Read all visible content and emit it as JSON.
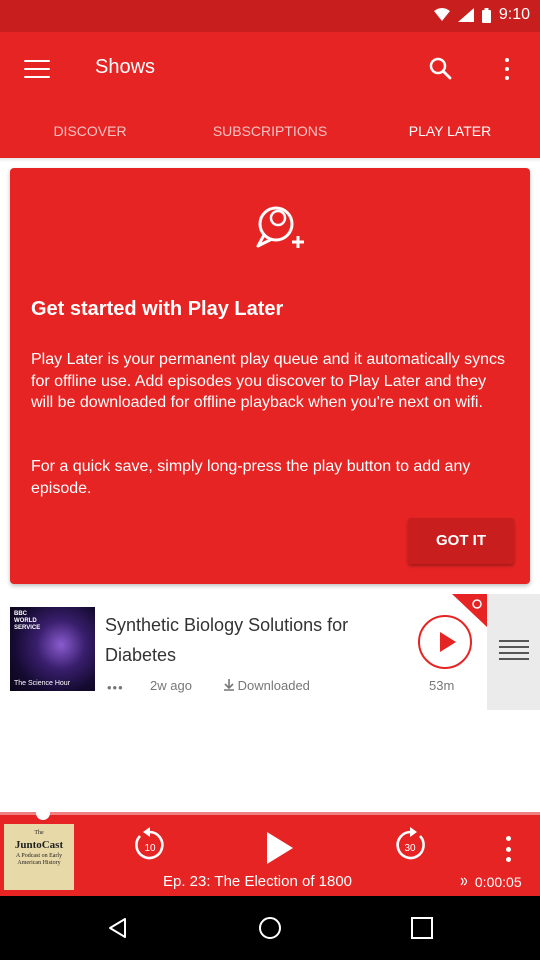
{
  "status_bar": {
    "time": "9:10"
  },
  "app_bar": {
    "title": "Shows",
    "tabs": [
      {
        "label": "DISCOVER",
        "active": false
      },
      {
        "label": "SUBSCRIPTIONS",
        "active": false
      },
      {
        "label": "PLAY LATER",
        "active": true
      }
    ]
  },
  "info_card": {
    "heading": "Get started with Play Later",
    "paragraph1": "Play Later is your permanent play queue and it automatically syncs for offline use. Add episodes you discover to Play Later and they will be downloaded for offline playback when you're next on wifi.",
    "paragraph2": "For a quick save, simply long-press the play button to add any episode.",
    "button_label": "GOT IT"
  },
  "episode": {
    "title": "Synthetic Biology Solutions for Diabetes",
    "thumbnail_brand": "BBC WORLD SERVICE",
    "thumbnail_show": "The Science Hour",
    "age": "2w ago",
    "download_status": "Downloaded",
    "duration": "53m"
  },
  "now_playing": {
    "artwork_line1": "The",
    "artwork_brand": "JuntoCast",
    "artwork_line2": "A Podcast on Early American History",
    "episode_title": "Ep. 23: The Election of 1800",
    "elapsed": "0:00:05",
    "rewind_seconds": "10",
    "forward_seconds": "30",
    "progress_fraction": 0.08
  },
  "colors": {
    "primary": "#e62424",
    "primary_dark": "#c81e1e",
    "handle_bg": "#ebebeb"
  },
  "icons": [
    "menu-icon",
    "search-icon",
    "more-vert-icon",
    "add-chat-icon",
    "play-icon",
    "drag-handle-icon",
    "rewind-10-icon",
    "forward-30-icon",
    "download-icon",
    "cast-icon"
  ]
}
